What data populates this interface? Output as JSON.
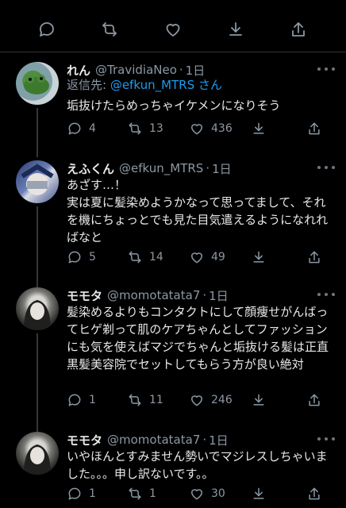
{
  "top_actions": [
    "reply-icon",
    "retweet-icon",
    "like-icon",
    "bookmark-icon",
    "share-icon"
  ],
  "tweets": [
    {
      "name": "れん",
      "handle": "@TravidiaNeo",
      "sep": "·",
      "time": "1日",
      "reply_prefix": "返信先: ",
      "reply_mention": "@efkun_MTRS",
      "reply_suffix": " さん",
      "text": "垢抜けたらめっちゃイケメンになりそう",
      "replies": "4",
      "retweets": "13",
      "likes": "436"
    },
    {
      "name": "えふくん",
      "handle": "@efkun_MTRS",
      "sep": "·",
      "time": "1日",
      "text": "あざす…！\n実は夏に髪染めようかなって思ってまして、それを機にちょっとでも見た目気遣えるようになれればなと",
      "replies": "5",
      "retweets": "14",
      "likes": "49"
    },
    {
      "name": "モモタ",
      "handle": "@momotatata7",
      "sep": "·",
      "time": "1日",
      "text": "髪染めるよりもコンタクトにして顔痩せがんばってヒゲ剃って肌のケアちゃんとしてファッションにも気を使えばマジでちゃんと垢抜ける髪は正直黒髪美容院でセットしてもらう方が良い絶対",
      "replies": "1",
      "retweets": "11",
      "likes": "246"
    },
    {
      "name": "モモタ",
      "handle": "@momotatata7",
      "sep": "·",
      "time": "1日",
      "text": "いやほんとすみません勢いでマジレスしちゃいました。。。申し訳ないです。。",
      "replies": "1",
      "retweets": "1",
      "likes": "30"
    }
  ]
}
